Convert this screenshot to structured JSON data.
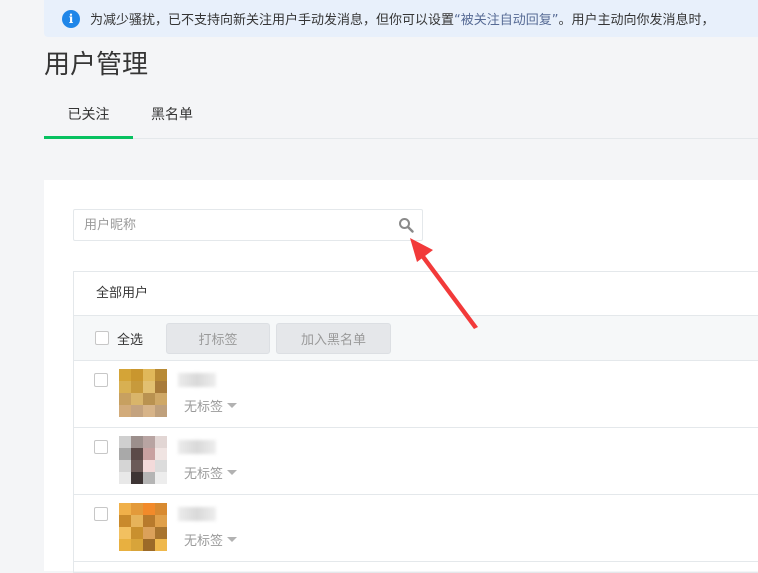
{
  "notice": {
    "icon": "info-icon",
    "text_before": "为减少骚扰，已不支持向新关注用户手动发消息，但你可以设置",
    "link": "“被关注自动回复”",
    "text_after": "。用户主动向你发消息时，"
  },
  "page_title": "用户管理",
  "tabs": [
    {
      "label": "已关注",
      "active": true
    },
    {
      "label": "黑名单",
      "active": false
    }
  ],
  "search": {
    "placeholder": "用户昵称",
    "value": "",
    "icon": "search-icon"
  },
  "group_header": "全部用户",
  "toolbar": {
    "select_all_label": "全选",
    "tag_button": "打标签",
    "blacklist_button": "加入黑名单"
  },
  "users": [
    {
      "tag_label": "无标签",
      "checked": false
    },
    {
      "tag_label": "无标签",
      "checked": false
    },
    {
      "tag_label": "无标签",
      "checked": false
    }
  ],
  "colors": {
    "accent_green": "#07c160",
    "info_blue": "#1f86e8",
    "notice_bg": "#e8f0fb",
    "link": "#576b95",
    "annotation_arrow": "#f23a3a"
  }
}
